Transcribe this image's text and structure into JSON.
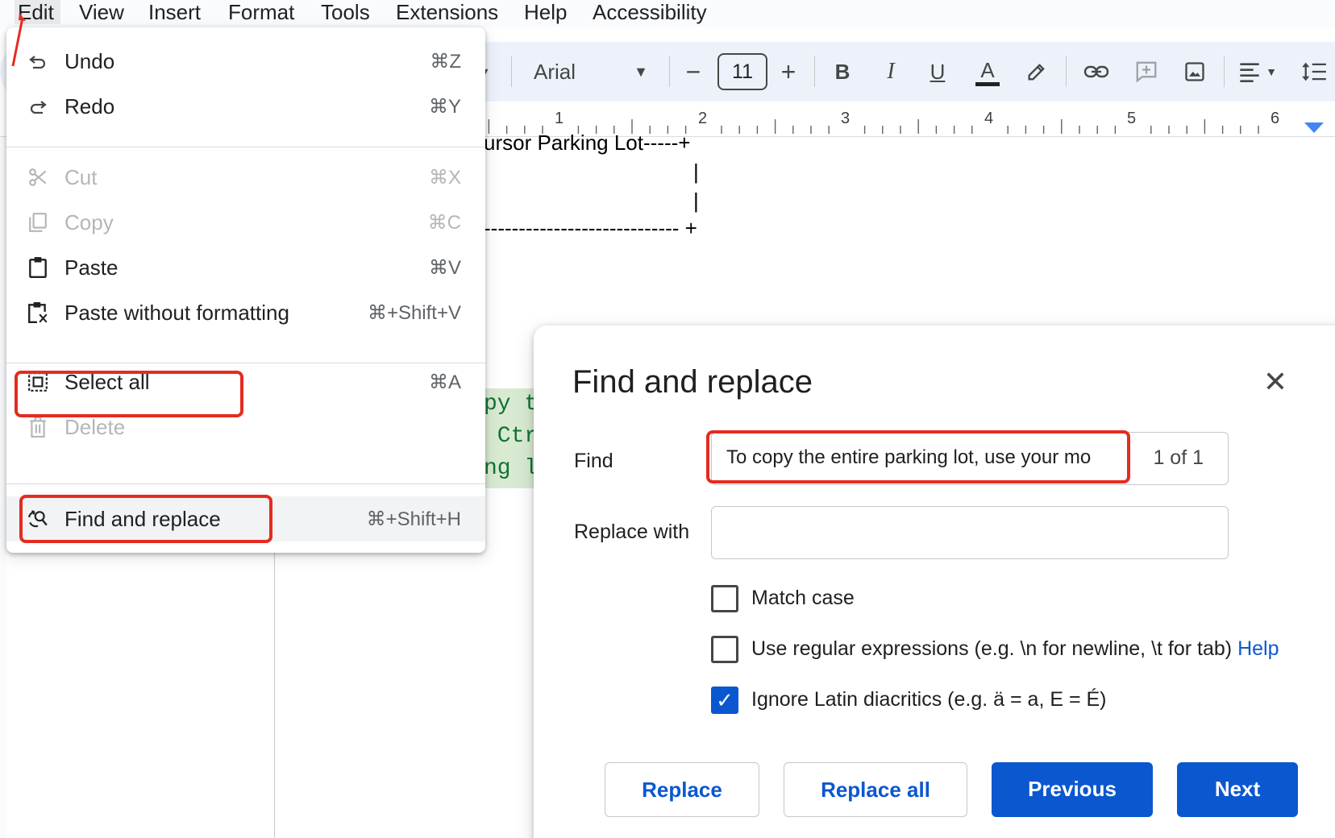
{
  "menubar": {
    "items": [
      "Edit",
      "View",
      "Insert",
      "Format",
      "Tools",
      "Extensions",
      "Help",
      "Accessibility"
    ]
  },
  "toolbar": {
    "font": "Arial",
    "font_size": "11",
    "decrease": "−",
    "increase": "+",
    "bold": "B",
    "italic": "I",
    "underline": "U",
    "text_color": "A"
  },
  "ruler": {
    "numbers": [
      "1",
      "2",
      "3",
      "4",
      "5",
      "6"
    ]
  },
  "document": {
    "line1": "ursor Parking Lot-----+",
    "bar": "|",
    "line4": "---------------------------- +",
    "code1": "py t",
    "code2": " Ctr",
    "code3": "ng l"
  },
  "edit_menu": {
    "items": [
      {
        "label": "Undo",
        "shortcut": "⌘Z",
        "icon": "undo-icon"
      },
      {
        "label": "Redo",
        "shortcut": "⌘Y",
        "icon": "redo-icon"
      },
      {
        "label": "Cut",
        "shortcut": "⌘X",
        "icon": "scissors-icon"
      },
      {
        "label": "Copy",
        "shortcut": "⌘C",
        "icon": "copy-icon"
      },
      {
        "label": "Paste",
        "shortcut": "⌘V",
        "icon": "clipboard-icon"
      },
      {
        "label": "Paste without formatting",
        "shortcut": "⌘+Shift+V",
        "icon": "paste-plain-icon"
      },
      {
        "label": "Select all",
        "shortcut": "⌘A",
        "icon": "select-all-icon"
      },
      {
        "label": "Delete",
        "shortcut": "",
        "icon": "trash-icon"
      },
      {
        "label": "Find and replace",
        "shortcut": "⌘+Shift+H",
        "icon": "find-replace-icon"
      }
    ]
  },
  "dialog": {
    "title": "Find and replace",
    "find_label": "Find",
    "find_value": "To copy the entire parking lot, use your mo",
    "find_count": "1 of 1",
    "replace_label": "Replace with",
    "replace_value": "",
    "match_case": "Match case",
    "regex": "Use regular expressions (e.g. \\n for newline, \\t for tab)",
    "help": "Help",
    "diacritics": "Ignore Latin diacritics (e.g. ä = a, E = É)",
    "checkmark": "✓",
    "close": "✕",
    "buttons": {
      "replace": "Replace",
      "replace_all": "Replace all",
      "previous": "Previous",
      "next": "Next"
    }
  },
  "colors": {
    "accent": "#0b57d0",
    "highlight": "#e52b20"
  }
}
